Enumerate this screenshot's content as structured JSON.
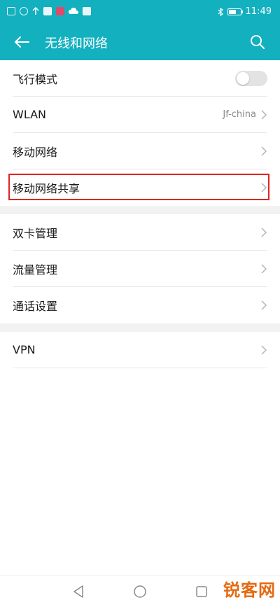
{
  "status_bar": {
    "time": "11:49",
    "battery_level": 0.6,
    "icons": [
      "sim-icon",
      "wifi-icon",
      "upload-icon",
      "notification-icon",
      "app-icon",
      "cloud-icon",
      "message-icon",
      "bluetooth-icon",
      "battery-icon"
    ]
  },
  "header": {
    "title": "无线和网络",
    "back_icon": "arrow-left-icon",
    "search_icon": "search-icon"
  },
  "groups": [
    {
      "items": [
        {
          "label": "飞行模式",
          "type": "toggle",
          "toggle_on": false
        },
        {
          "label": "WLAN",
          "value": "Jf-china",
          "type": "link"
        },
        {
          "label": "移动网络",
          "type": "link"
        },
        {
          "label": "移动网络共享",
          "type": "link",
          "highlighted": true
        }
      ]
    },
    {
      "items": [
        {
          "label": "双卡管理",
          "type": "link"
        },
        {
          "label": "流量管理",
          "type": "link"
        },
        {
          "label": "通话设置",
          "type": "link"
        }
      ]
    },
    {
      "items": [
        {
          "label": "VPN",
          "type": "link"
        }
      ]
    }
  ],
  "nav_bar": {
    "icons": [
      "nav-back-icon",
      "nav-home-icon",
      "nav-recent-icon"
    ]
  },
  "watermark": "锐客网",
  "colors": {
    "accent": "#13b0bf",
    "highlight": "#e02424",
    "watermark": "#e46a12"
  }
}
